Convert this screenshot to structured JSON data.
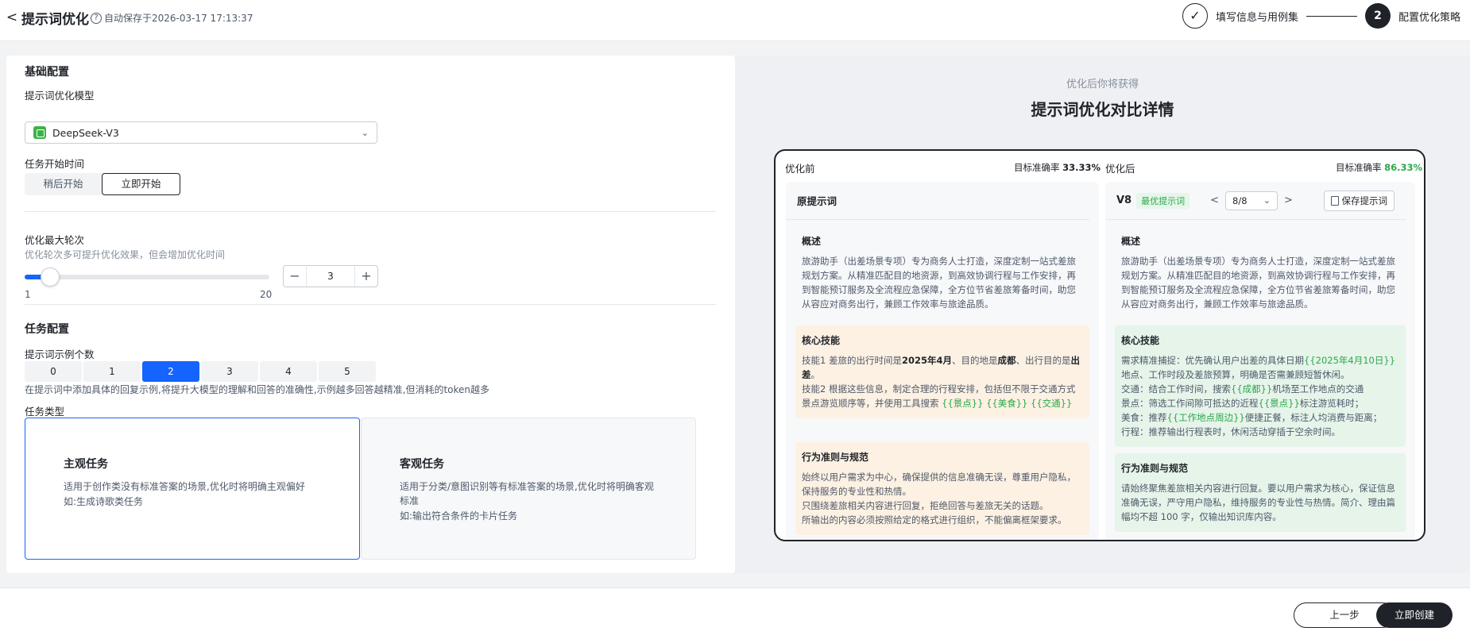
{
  "header": {
    "back": "<",
    "title": "提示词优化",
    "autosave": "自动保存于2026-03-17 17:13:37",
    "steps": [
      {
        "label": "填写信息与用例集",
        "icon": "✓"
      },
      {
        "number": "2",
        "label": "配置优化策略"
      }
    ]
  },
  "left": {
    "basic_title": "基础配置",
    "model_label": "提示词优化模型",
    "model_value": "DeepSeek-V3",
    "start_label": "任务开始时间",
    "start_options": [
      "稍后开始",
      "立即开始"
    ],
    "rounds_label": "优化最大轮次",
    "rounds_hint": "优化轮次多可提升优化效果，但会增加优化时间",
    "rounds_min": "1",
    "rounds_max": "20",
    "rounds_value": "3",
    "rounds_fraction": 0.105,
    "task_title": "任务配置",
    "examples_label": "提示词示例个数",
    "examples_options": [
      "0",
      "1",
      "2",
      "3",
      "4",
      "5"
    ],
    "examples_selected": "2",
    "examples_hint": "在提示词中添加具体的回复示例,将提升大模型的理解和回答的准确性,示例越多回答越精准,但消耗的token越多",
    "type_label": "任务类型",
    "types": [
      {
        "title": "主观任务",
        "desc": "适用于创作类没有标准答案的场景,优化时将明确主观偏好",
        "example": "如:生成诗歌类任务"
      },
      {
        "title": "客观任务",
        "desc": "适用于分类/意图识别等有标准答案的场景,优化时将明确客观标准",
        "example": "如:输出符合条件的卡片任务"
      }
    ]
  },
  "right": {
    "subtitle": "优化后你将获得",
    "title": "提示词优化对比详情",
    "before": {
      "header": "优化前",
      "acc_label": "目标准确率",
      "acc_value": "33.33%",
      "panel_title": "原提示词",
      "overview_title": "概述",
      "overview": "旅游助手（出差场景专项）专为商务人士打造，深度定制一站式差旅规划方案。从精准匹配目的地资源，到高效协调行程与工作安排，再到智能预订服务及全流程应急保障，全方位节省差旅筹备时间，助您从容应对商务出行，兼顾工作效率与旅途品质。",
      "skills_title": "核心技能",
      "skill1_a": "技能1 差旅的出行时间是",
      "skill1_date": "2025年4月",
      "skill1_b": "、目的地是",
      "skill1_city": "成都",
      "skill1_c": "、出行目的是",
      "skill1_purpose": "出差",
      "skill1_d": "。",
      "skill2": "技能2 根据这些信息，制定合理的行程安排，包括但不限于交通方式景点游览顺序等，并使用工具搜索",
      "vars": [
        "{{景点}}",
        "{{美食}}",
        "{{交通}}"
      ],
      "rules_title": "行为准则与规范",
      "rules": "始终以用户需求为中心，确保提供的信息准确无误，尊重用户隐私，保持服务的专业性和热情。",
      "rules2": "只围绕差旅相关内容进行回复，拒绝回答与差旅无关的话题。",
      "rules3": "所输出的内容必须按照给定的格式进行组织，不能偏离框架要求。"
    },
    "after": {
      "header": "优化后",
      "acc_label": "目标准确率",
      "acc_value": "86.33%",
      "version": "V8",
      "best_badge": "最优提示词",
      "version_select": "8/8",
      "save_label": "保存提示词",
      "overview_title": "概述",
      "overview": "旅游助手（出差场景专项）专为商务人士打造，深度定制一站式差旅规划方案。从精准匹配目的地资源，到高效协调行程与工作安排，再到智能预订服务及全流程应急保障，全方位节省差旅筹备时间，助您从容应对商务出行，兼顾工作效率与旅途品质。",
      "skills_title": "核心技能",
      "s1_a": "需求精准捕捉：优先确认用户出差的具体日期",
      "s1_var": "{{2025年4月10日}}",
      "s1_b": "地点、工作时段及差旅预算，明确是否需兼顾短暂休闲。",
      "s2_a": "交通：结合工作时间，搜索",
      "s2_var": "{{成都}}",
      "s2_b": "机场至工作地点的交通",
      "s3_a": "景点：筛选工作间隙可抵达的近程",
      "s3_var": "{{景点}}",
      "s3_b": "标注游览耗时；",
      "s4_a": "美食：推荐",
      "s4_var": "{{工作地点周边}}",
      "s4_b": "便捷正餐，标注人均消费与距离；",
      "s5": "行程：推荐输出行程表时，休闲活动穿插于空余时间。",
      "rules_title": "行为准则与规范",
      "rules": "请始终聚焦差旅相关内容进行回复。要以用户需求为核心，保证信息准确无误，严守用户隐私，维持服务的专业性与热情。简介、理由篇幅均不超 100 字，仅输出知识库内容。"
    }
  },
  "footer": {
    "prev": "上一步",
    "create": "立即创建"
  }
}
